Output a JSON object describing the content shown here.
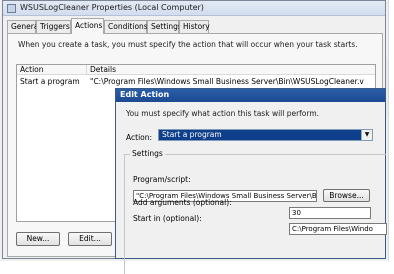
{
  "properties_dialog": {
    "title": "WSUSLogCleaner Properties (Local Computer)",
    "tabs": [
      "General",
      "Triggers",
      "Actions",
      "Conditions",
      "Settings",
      "History"
    ],
    "active_tab": "Actions",
    "intro_text": "When you create a task, you must specify the action that will occur when your task starts.",
    "list": {
      "columns": [
        "Action",
        "Details"
      ],
      "rows": [
        {
          "action": "Start a program",
          "details": "\"C:\\Program Files\\Windows Small Business Server\\Bin\\WSUSLogCleaner.v"
        }
      ]
    },
    "buttons": {
      "new": "New...",
      "edit": "Edit..."
    }
  },
  "edit_action_dialog": {
    "title": "Edit Action",
    "instruction": "You must specify what action this task will perform.",
    "action_label": "Action:",
    "action_value": "Start a program",
    "settings_legend": "Settings",
    "program_label": "Program/script:",
    "program_value": "\"C:\\Program Files\\Windows Small Business Server\\Bin\\W",
    "browse_label": "Browse...",
    "args_label": "Add arguments (optional):",
    "args_value": "30",
    "start_label": "Start in (optional):",
    "start_value": "C:\\Program Files\\Windo"
  },
  "colors": {
    "title_active": "#1b4a92",
    "selection": "#0f3f8a"
  }
}
